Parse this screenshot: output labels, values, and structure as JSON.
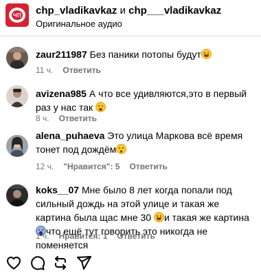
{
  "header": {
    "avatar_text": "ЧП",
    "account_1": "chp_vladikavkaz",
    "joiner": " и ",
    "account_2": "chp___vladikavkaz",
    "subtitle": "Оригинальное аудио"
  },
  "comments": [
    {
      "username": "zaur211987",
      "text": "Без паники потопы будут",
      "emoji": "grinning-sweat-face",
      "time": "11 ч.",
      "reply_label": "Ответить"
    },
    {
      "username": "avizena985",
      "text": "А что все удивляются,это в первый раз у нас так",
      "emoji": "grinning-face",
      "time": "8 ч.",
      "reply_label": "Ответить"
    },
    {
      "username": "alena_puhaeva",
      "text": "Это улица Маркова всё время тонет под дождём",
      "emoji": "astonished-face",
      "time": "12 ч.",
      "likes_label": "\"Нравится\": 5",
      "reply_label": "Ответить"
    },
    {
      "username": "koks__07",
      "text_part1": "Мне было 8 лет когда попали под сильный дождь на этой улице и такая же картина была щас мне 30",
      "emoji1": "grinning-sweat-face",
      "text_part2": "и такая же картина",
      "emoji2": "screaming-face",
      "text_part3": "что ещё тут говорить это никогда не поменяется",
      "time": "1 ч.",
      "likes_label": "Нравится: 1",
      "reply_label": "Ответить"
    }
  ],
  "action_bar": {
    "icons": [
      "heart-icon",
      "comment-icon",
      "repost-icon",
      "share-icon"
    ]
  },
  "colors": {
    "brand_red": "#d52233",
    "meta_gray": "#737373",
    "text": "#000000"
  }
}
